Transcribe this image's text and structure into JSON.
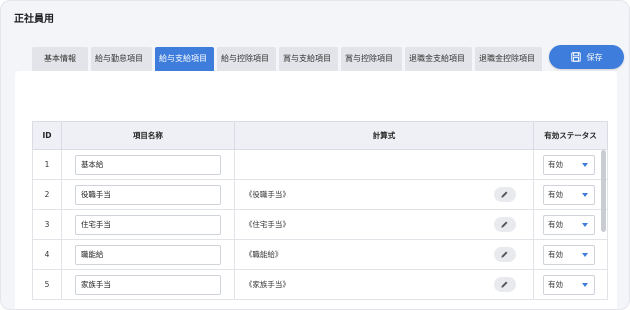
{
  "page_title": "正社員用",
  "tabs": [
    {
      "label": "基本情報",
      "active": false
    },
    {
      "label": "給与勤怠項目",
      "active": false
    },
    {
      "label": "給与支給項目",
      "active": true
    },
    {
      "label": "給与控除項目",
      "active": false
    },
    {
      "label": "賞与支給項目",
      "active": false
    },
    {
      "label": "賞与控除項目",
      "active": false
    },
    {
      "label": "退職金支給項目",
      "active": false
    },
    {
      "label": "退職金控除項目",
      "active": false
    }
  ],
  "save_label": "保存",
  "table": {
    "headers": {
      "id": "ID",
      "name": "項目名称",
      "formula": "計算式",
      "status": "有効ステータス"
    },
    "rows": [
      {
        "id": "1",
        "name": "基本給",
        "formula": "",
        "status": "有効"
      },
      {
        "id": "2",
        "name": "役職手当",
        "formula": "《役職手当》",
        "status": "有効"
      },
      {
        "id": "3",
        "name": "住宅手当",
        "formula": "《住宅手当》",
        "status": "有効"
      },
      {
        "id": "4",
        "name": "職能給",
        "formula": "《職能給》",
        "status": "有効"
      },
      {
        "id": "5",
        "name": "家族手当",
        "formula": "《家族手当》",
        "status": "有効"
      }
    ]
  },
  "colors": {
    "accent": "#3e7ddb",
    "header_bg": "#eef0f5",
    "page_bg": "#f4f5f8"
  },
  "icons": {
    "save": "save-icon",
    "edit": "pencil-icon",
    "dropdown": "chevron-down-icon"
  }
}
